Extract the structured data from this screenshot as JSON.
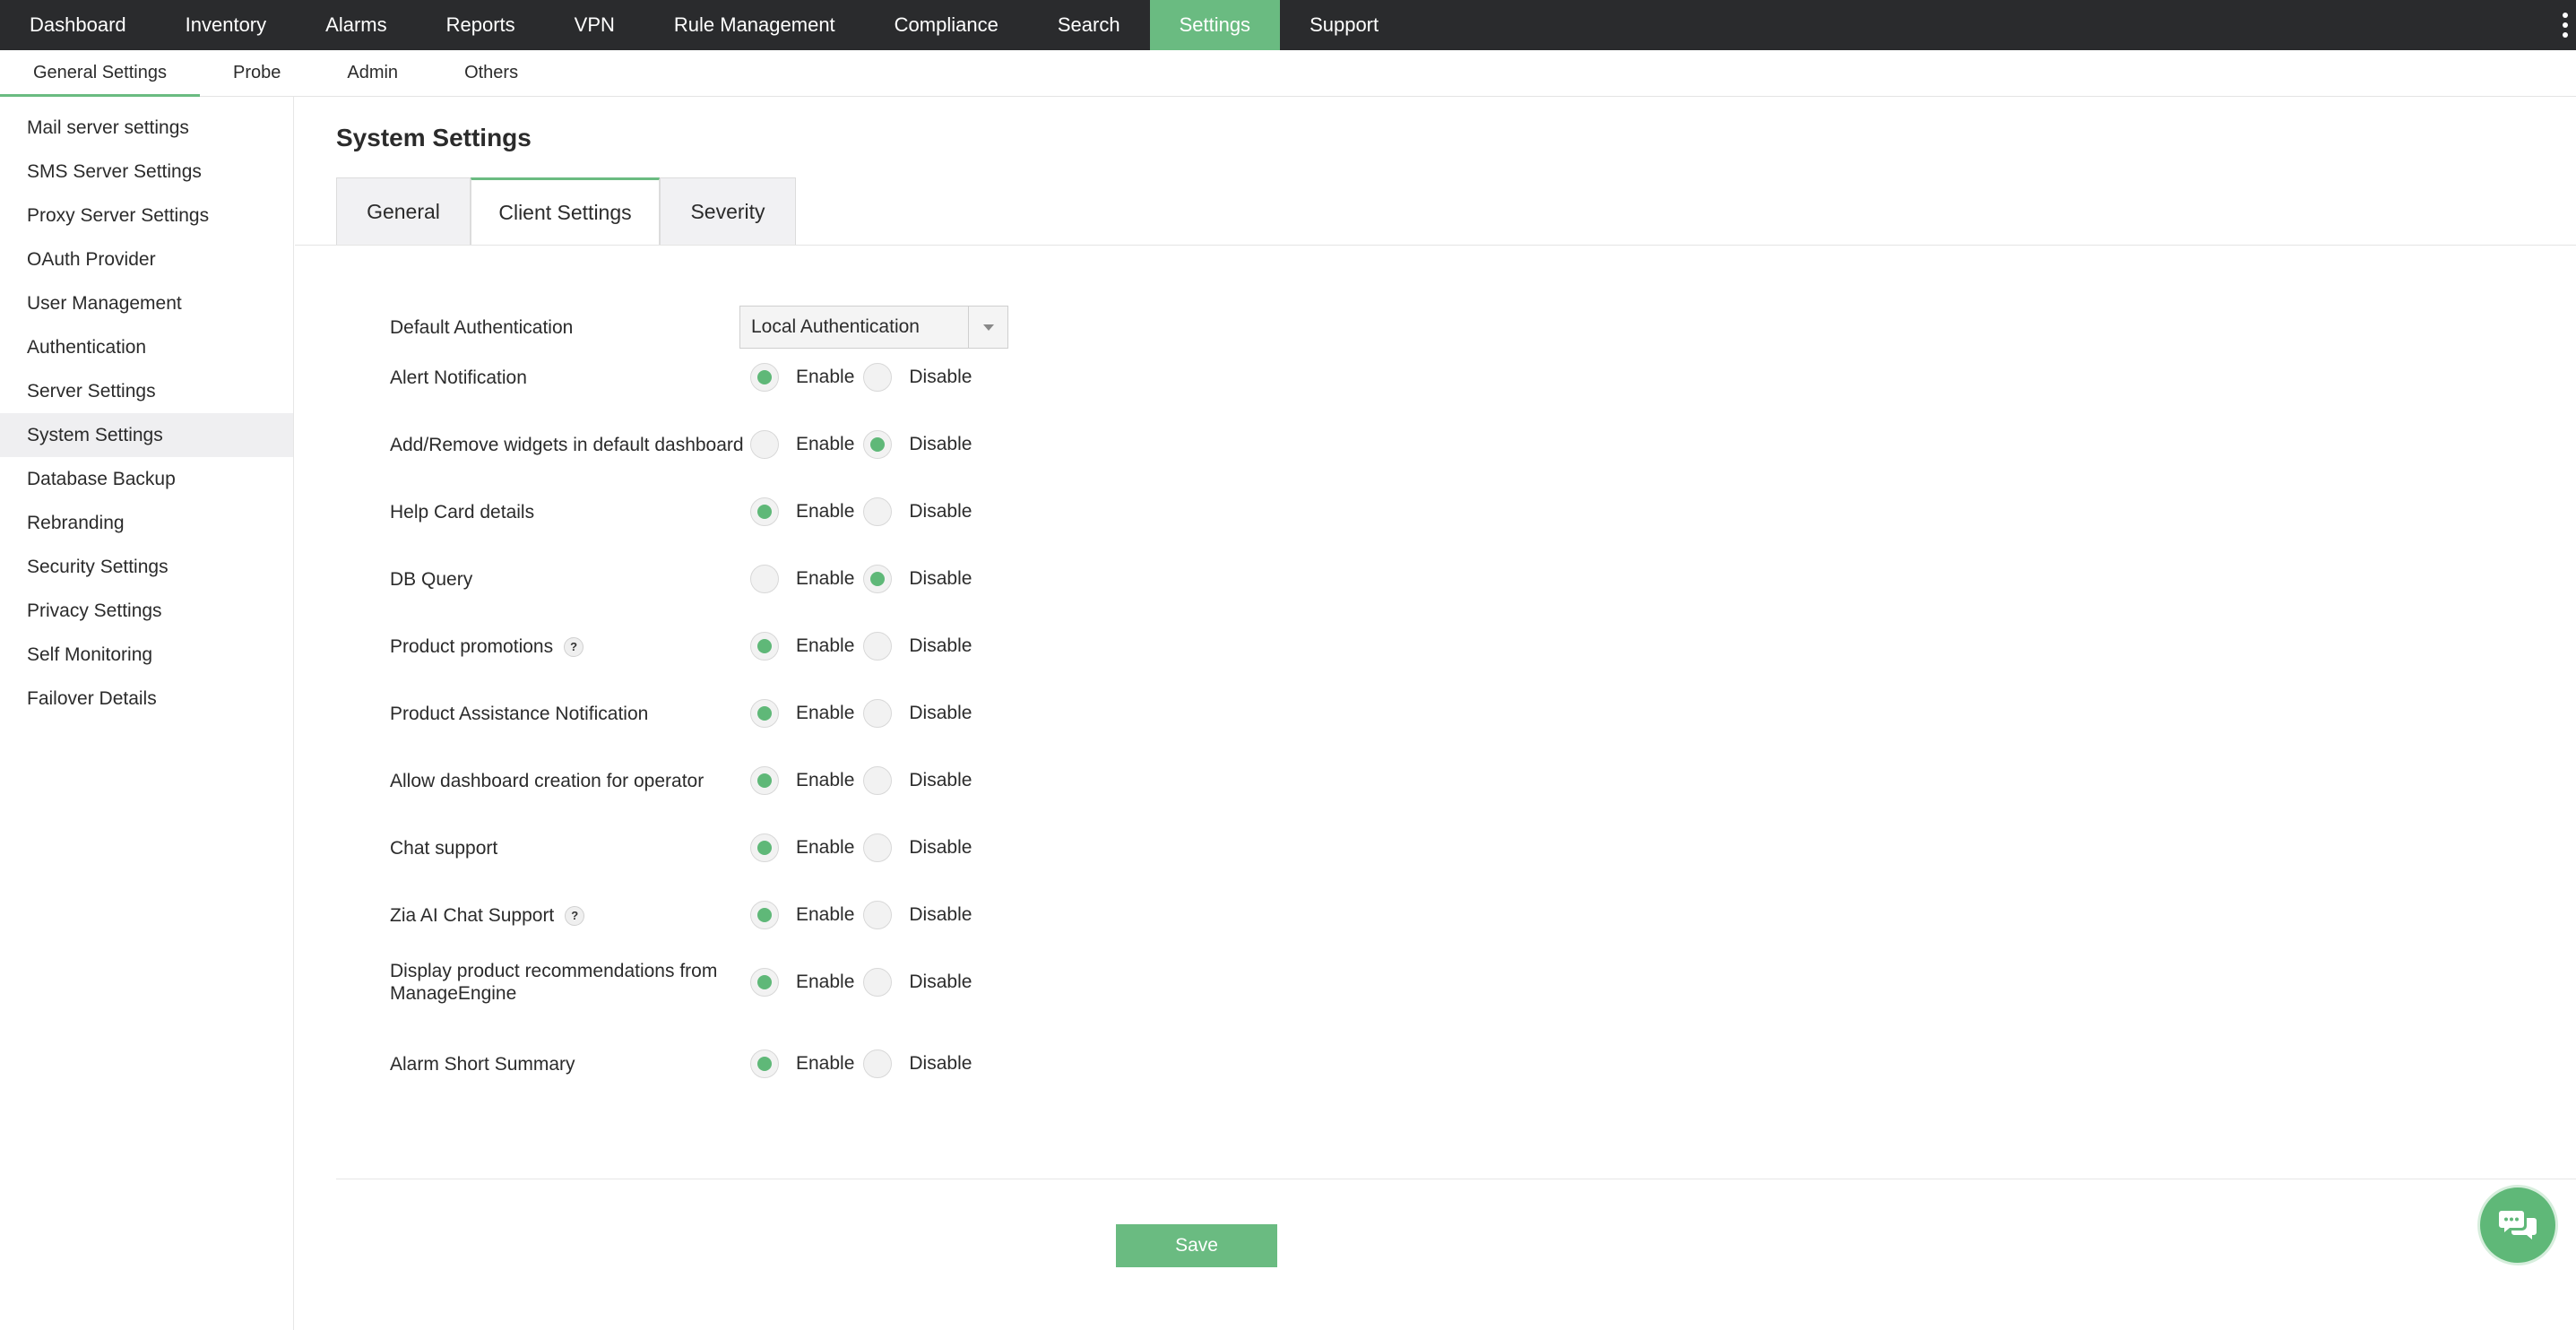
{
  "topnav": {
    "items": [
      {
        "label": "Dashboard",
        "active": false
      },
      {
        "label": "Inventory",
        "active": false
      },
      {
        "label": "Alarms",
        "active": false
      },
      {
        "label": "Reports",
        "active": false
      },
      {
        "label": "VPN",
        "active": false
      },
      {
        "label": "Rule Management",
        "active": false
      },
      {
        "label": "Compliance",
        "active": false
      },
      {
        "label": "Search",
        "active": false
      },
      {
        "label": "Settings",
        "active": true
      },
      {
        "label": "Support",
        "active": false
      }
    ],
    "more_icon": "kebab-menu-icon"
  },
  "subnav": {
    "items": [
      {
        "label": "General Settings",
        "active": true
      },
      {
        "label": "Probe",
        "active": false
      },
      {
        "label": "Admin",
        "active": false
      },
      {
        "label": "Others",
        "active": false
      }
    ]
  },
  "sidebar": {
    "items": [
      {
        "label": "Mail server settings"
      },
      {
        "label": "SMS Server Settings"
      },
      {
        "label": "Proxy Server Settings"
      },
      {
        "label": "OAuth Provider"
      },
      {
        "label": "User Management"
      },
      {
        "label": "Authentication"
      },
      {
        "label": "Server Settings"
      },
      {
        "label": "System Settings",
        "active": true
      },
      {
        "label": "Database Backup"
      },
      {
        "label": "Rebranding"
      },
      {
        "label": "Security Settings"
      },
      {
        "label": "Privacy Settings"
      },
      {
        "label": "Self Monitoring"
      },
      {
        "label": "Failover Details"
      }
    ]
  },
  "page": {
    "title": "System Settings",
    "tabs": [
      {
        "label": "General"
      },
      {
        "label": "Client Settings",
        "active": true
      },
      {
        "label": "Severity"
      }
    ]
  },
  "form": {
    "default_auth_label": "Default Authentication",
    "default_auth_value": "Local Authentication",
    "enable_label": "Enable",
    "disable_label": "Disable",
    "help_glyph": "?",
    "settings": [
      {
        "label": "Alert Notification",
        "value": "enable",
        "help": false
      },
      {
        "label": "Add/Remove widgets in default dashboard",
        "value": "disable",
        "help": false
      },
      {
        "label": "Help Card details",
        "value": "enable",
        "help": false
      },
      {
        "label": "DB Query",
        "value": "disable",
        "help": false
      },
      {
        "label": "Product promotions",
        "value": "enable",
        "help": true
      },
      {
        "label": "Product Assistance Notification",
        "value": "enable",
        "help": false
      },
      {
        "label": "Allow dashboard creation for operator",
        "value": "enable",
        "help": false
      },
      {
        "label": "Chat support",
        "value": "enable",
        "help": false
      },
      {
        "label": "Zia AI Chat Support",
        "value": "enable",
        "help": true
      },
      {
        "label": "Display product recommendations from ManageEngine",
        "value": "enable",
        "help": false
      },
      {
        "label": "Alarm Short Summary",
        "value": "enable",
        "help": false
      }
    ],
    "save_label": "Save"
  },
  "chat": {
    "icon": "chat-bubbles-icon"
  },
  "colors": {
    "accent": "#6abb81",
    "topbar": "#2a2b2d",
    "radio_dot": "#5fb878"
  }
}
